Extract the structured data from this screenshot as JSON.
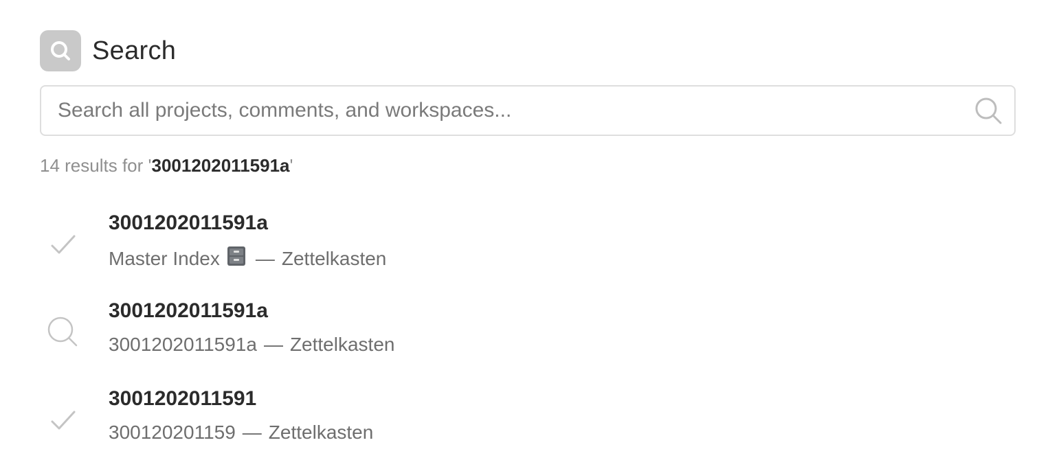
{
  "header": {
    "title": "Search",
    "icon": "search-icon"
  },
  "search": {
    "placeholder": "Search all projects, comments, and workspaces...",
    "value": ""
  },
  "summary": {
    "prefix": "14 results for '",
    "query": "3001202011591a",
    "suffix": "'"
  },
  "results": [
    {
      "title": "3001202011591a",
      "icon": "checkmark-icon",
      "project": "Master Index",
      "project_emoji": "file-cabinet-icon",
      "separator": "—",
      "workspace": "Zettelkasten"
    },
    {
      "title": "3001202011591a",
      "icon": "search-icon",
      "project": "3001202011591a",
      "separator": "—",
      "workspace": "Zettelkasten"
    },
    {
      "title": "3001202011591",
      "icon": "checkmark-icon",
      "project": "300120201159",
      "separator": "—",
      "workspace": "Zettelkasten"
    }
  ],
  "colors": {
    "header_icon_bg": "#c9c9c9",
    "text_primary": "#2b2b2b",
    "text_secondary": "#6e6e6e",
    "text_muted": "#8f8f8f",
    "border": "#dedede",
    "icon_gray": "#c4c4c4"
  }
}
